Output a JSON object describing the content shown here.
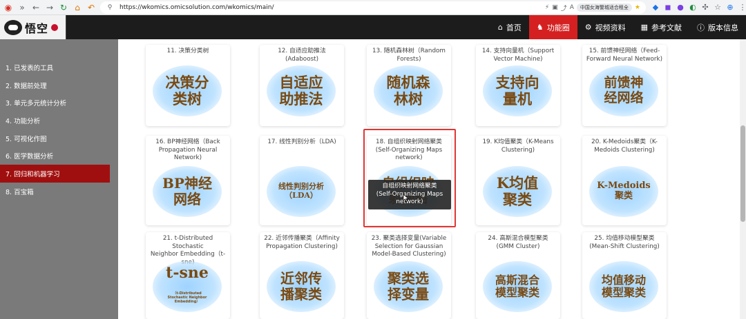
{
  "browser": {
    "url": "https://wkomics.omicsolution.com/wkomics/main/",
    "extension_label": "中国女海警城适合租全"
  },
  "header": {
    "logo_text": "悟空",
    "nav": [
      {
        "label": "首页",
        "icon": "home-icon",
        "glyph": "⌂"
      },
      {
        "label": "功能圈",
        "icon": "tool-icon",
        "glyph": "♞"
      },
      {
        "label": "视频资料",
        "icon": "gears-icon",
        "glyph": "⚙"
      },
      {
        "label": "参考文献",
        "icon": "table-icon",
        "glyph": "▦"
      },
      {
        "label": "版本信息",
        "icon": "info-icon",
        "glyph": "ⓘ"
      }
    ]
  },
  "sidebar": {
    "items": [
      {
        "label": "1. 已发表的工具"
      },
      {
        "label": "2. 数据前处理"
      },
      {
        "label": "3. 单元多元统计分析"
      },
      {
        "label": "4. 功能分析"
      },
      {
        "label": "5. 可视化作图"
      },
      {
        "label": "6. 医学数据分析"
      },
      {
        "label": "7. 回归和机器学习"
      },
      {
        "label": "8. 百宝箱"
      }
    ]
  },
  "cards": [
    {
      "title": "11. 决策分类树",
      "art": "决策分\n类树"
    },
    {
      "title": "12. 自适应助推法\n(Adaboost)",
      "art": "自适应\n助推法"
    },
    {
      "title": "13. 随机森林树（Random\nForests)",
      "art": "随机森\n林树"
    },
    {
      "title": "14. 支持向量机（Support\nVector Machine)",
      "art": "支持向\n量机"
    },
    {
      "title": "15. 前馈神经网络（Feed-\nForward Neural Network)",
      "art": "前馈神\n经网络"
    },
    {
      "title": "16. BP神经网络（Back\nPropagation Neural\nNetwork)",
      "art": "BP神经\n网络"
    },
    {
      "title": "17. 线性判别分析（LDA)",
      "art": "线性判别分析\n（LDA）"
    },
    {
      "title": "18. 自组织映射网络聚类\n(Self-Organizing Maps\nnetwork)",
      "art": "自组织映\n射网络"
    },
    {
      "title": "19. K均值聚类（K-Means\nClustering)",
      "art": "K均值\n聚类"
    },
    {
      "title": "20. K-Medoids聚类（K-\nMedoids Clustering)",
      "art": "K-Medoids\n聚类"
    },
    {
      "title": "21. t-Distributed Stochastic\nNeighbor Embedding（t-\nsne)",
      "art": "t-sne",
      "art_sub": "（t-Distributed\nStochastic Neighbor\nEmbedding）"
    },
    {
      "title": "22. 近邻传播聚类（Affinity\nPropagation Clustering)",
      "art": "近邻传\n播聚类"
    },
    {
      "title": "23. 聚类选择变量(Variable\nSelection for Gaussian\nModel-Based Clustering)",
      "art": "聚类选\n择变量"
    },
    {
      "title": "24. 高斯混合模型聚类\n(GMM Cluster)",
      "art": "高斯混合\n模型聚类"
    },
    {
      "title": "25. 均值移动模型聚类\n(Mean-Shift Clustering)",
      "art": "均值移动\n模型聚类"
    }
  ],
  "tooltip": {
    "text": "自组织映射网络聚类\n(Self-Organizing Maps\nnetwork)"
  }
}
